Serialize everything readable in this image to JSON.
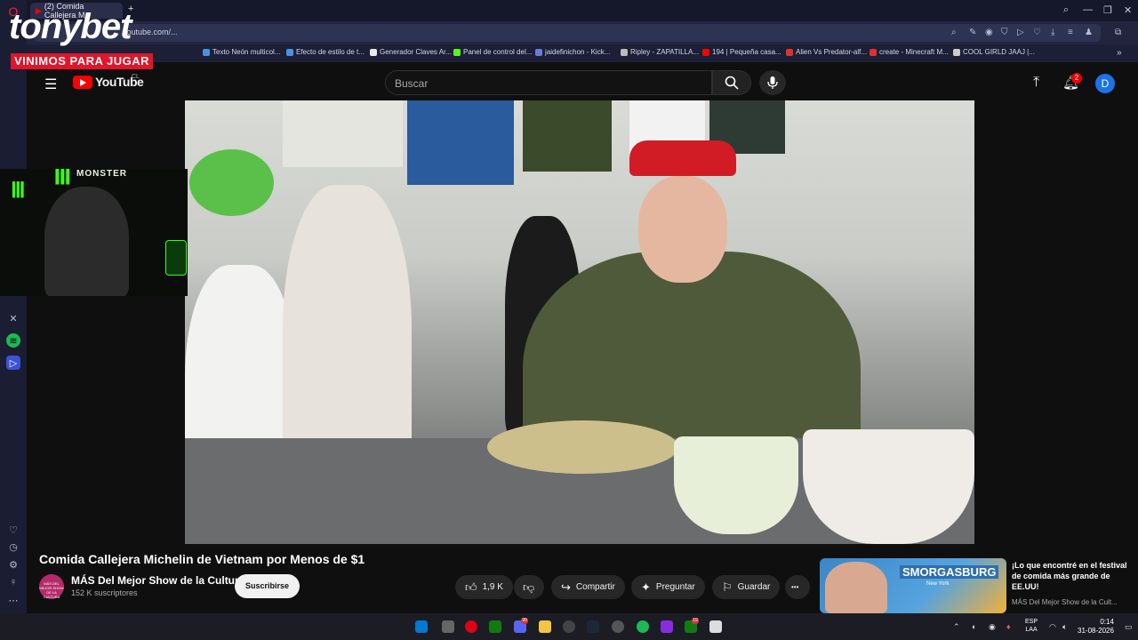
{
  "overlay": {
    "brand": "tonybet",
    "slogan": "VINIMOS PARA JUGAR",
    "webcam_sponsor": "MONSTER"
  },
  "browser": {
    "tab_title": "(2) Comida Callejera M",
    "new_tab": "+",
    "url": "youtube.com/...",
    "window_controls": [
      "—",
      "❐",
      "✕"
    ],
    "bookmarks": [
      {
        "label": "Texto Neón multicol...",
        "color": "#4a90e2"
      },
      {
        "label": "Efecto de estilo de t...",
        "color": "#4a90e2"
      },
      {
        "label": "Generador Claves Ar...",
        "color": "#e8e8e8"
      },
      {
        "label": "Panel de control del...",
        "color": "#53fc18"
      },
      {
        "label": "jaidefinichon - Kick...",
        "color": "#6b7bd6"
      },
      {
        "label": "Ripley - ZAPATILLA...",
        "color": "#bbbbbb"
      },
      {
        "label": "194 | Pequeña casa...",
        "color": "#ff0000"
      },
      {
        "label": "Alien Vs Predator-alf...",
        "color": "#e03131"
      },
      {
        "label": "create - Minecraft M...",
        "color": "#e03131"
      },
      {
        "label": "COOL GIRLD JAAJ |...",
        "color": "#cccccc"
      }
    ]
  },
  "youtube": {
    "logo_text": "YouTube",
    "country": "CL",
    "search_placeholder": "Buscar",
    "notifications": "2",
    "avatar_letter": "D"
  },
  "video": {
    "title": "Comida Callejera Michelin de Vietnam por Menos de $1",
    "channel": "MÁS Del Mejor Show de la Cultura",
    "channel_avatar_text": "MÁS DEL MEJOR SHOW DE LA CULTURA",
    "subscribers": "152 K suscriptores",
    "subscribe_label": "Suscribirse",
    "likes": "1,9 K",
    "share_label": "Compartir",
    "ask_label": "Preguntar",
    "save_label": "Guardar",
    "more": "•••"
  },
  "recommendation": {
    "title": "¡Lo que encontré en el festival de comida más grande de EE.UU!",
    "channel": "MÁS Del Mejor Show de la Cult...",
    "thumb_text": "SMORGASBURG",
    "thumb_subtext": "New York"
  },
  "taskbar": {
    "lang": "ESP",
    "layout": "LAA",
    "time": "0:14",
    "date": "31-08-2026",
    "badges": [
      "99",
      "19"
    ]
  }
}
